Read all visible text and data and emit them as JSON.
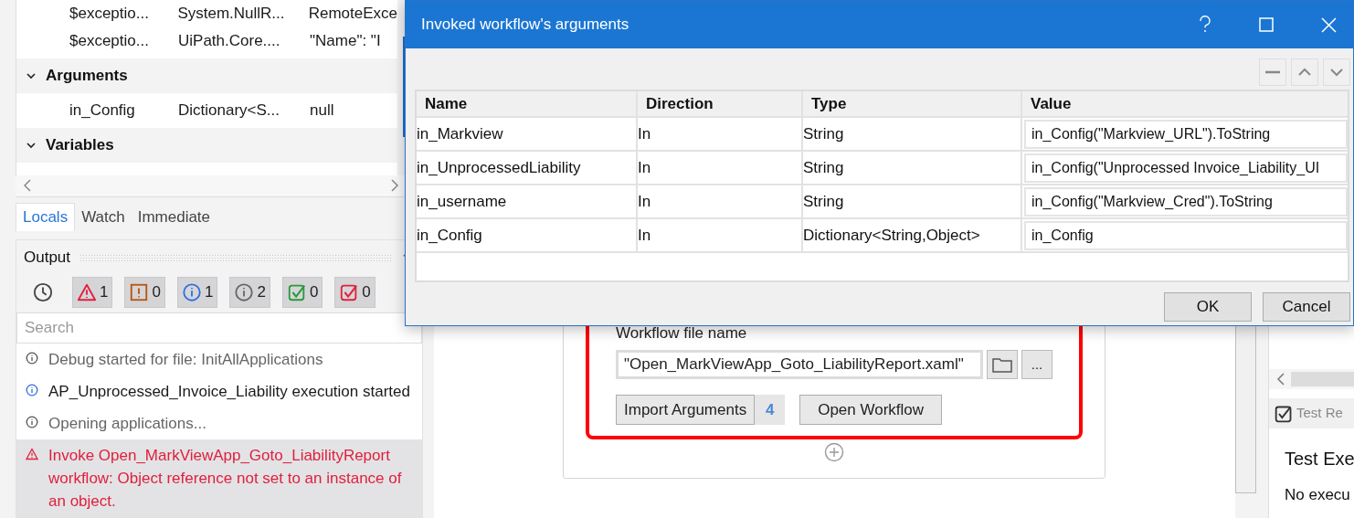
{
  "locals": {
    "top_rows": [
      {
        "name": "$exceptio...",
        "type": "System.NullR...",
        "value": "RemoteExce"
      },
      {
        "name": "$exceptio...",
        "type": "UiPath.Core....",
        "value": "\"Name\": \"I"
      }
    ],
    "groups": [
      {
        "label": "Arguments",
        "expanded": true,
        "children": [
          {
            "name": "in_Config",
            "type": "Dictionary<S...",
            "value": "null"
          }
        ]
      },
      {
        "label": "Variables",
        "expanded": true
      }
    ]
  },
  "tabs": [
    {
      "label": "Locals",
      "selected": true
    },
    {
      "label": "Watch",
      "selected": false
    },
    {
      "label": "Immediate",
      "selected": false
    }
  ],
  "output": {
    "title": "Output",
    "filters": [
      {
        "kind": "error",
        "count": "1",
        "pressed": true
      },
      {
        "kind": "warning",
        "count": "0",
        "pressed": true
      },
      {
        "kind": "info",
        "count": "1",
        "pressed": true
      },
      {
        "kind": "trace",
        "count": "2",
        "pressed": true
      },
      {
        "kind": "passed",
        "count": "0",
        "pressed": true
      },
      {
        "kind": "failed",
        "count": "0",
        "pressed": true
      }
    ],
    "search": {
      "placeholder": "Search"
    },
    "entries": [
      {
        "kind": "trace",
        "text": "Debug started for file: InitAllApplications",
        "selected": false
      },
      {
        "kind": "info",
        "text": "AP_Unprocessed_Invoice_Liability execution started",
        "selected": false
      },
      {
        "kind": "trace",
        "text": "Opening applications...",
        "selected": false
      },
      {
        "kind": "error",
        "text": "Invoke Open_MarkViewApp_Goto_LiabilityReport workflow: Object reference not set to an instance of an object.",
        "selected": true
      }
    ]
  },
  "designer": {
    "file_label": "Workflow file name",
    "file_value": "\"Open_MarkViewApp_Goto_LiabilityReport.xaml\"",
    "browse_button": "...",
    "import_button": "Import Arguments",
    "argument_count": "4",
    "open_button": "Open Workflow"
  },
  "test_panel": {
    "tab": "Test Re",
    "heading": "Test Exe",
    "message": "No execu"
  },
  "dialog": {
    "title": "Invoked workflow's arguments",
    "columns": [
      "Name",
      "Direction",
      "Type",
      "Value"
    ],
    "rows": [
      {
        "name": "in_Markview",
        "direction": "In",
        "type": "String",
        "value": "in_Config(\"Markview_URL\").ToString"
      },
      {
        "name": "in_UnprocessedLiability",
        "direction": "In",
        "type": "String",
        "value": "in_Config(\"Unprocessed Invoice_Liability_UI"
      },
      {
        "name": "in_username",
        "direction": "In",
        "type": "String",
        "value": "in_Config(\"Markview_Cred\").ToString"
      },
      {
        "name": "in_Config",
        "direction": "In",
        "type": "Dictionary<String,Object>",
        "value": "in_Config"
      }
    ],
    "buttons": [
      "OK",
      "Cancel"
    ]
  }
}
